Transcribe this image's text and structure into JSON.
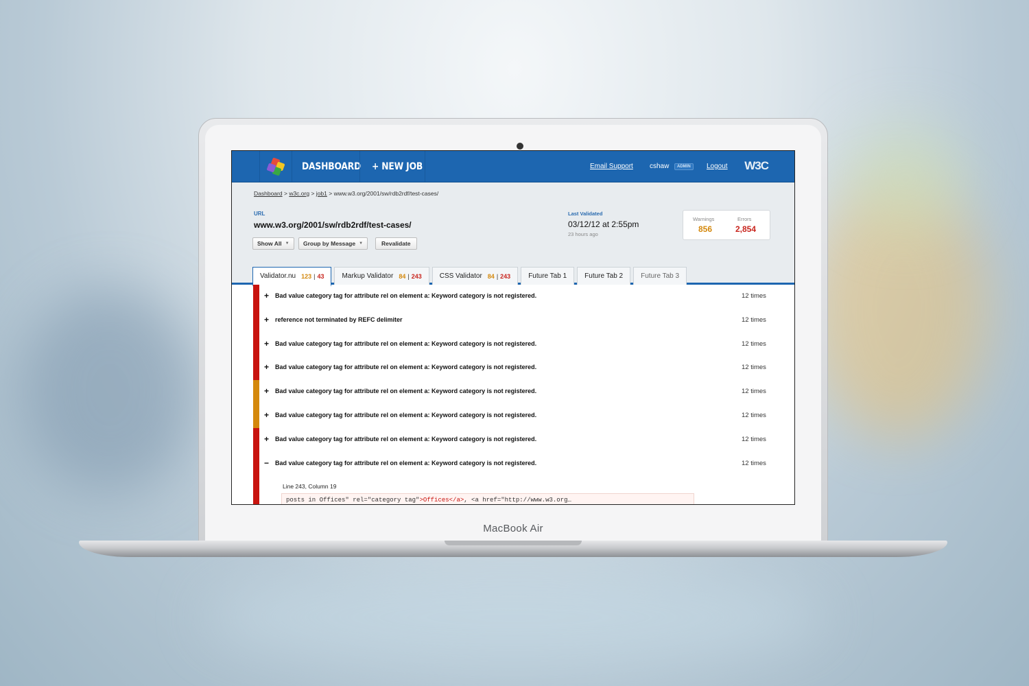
{
  "device": {
    "brand": "MacBook Air"
  },
  "nav": {
    "dashboard": "DASHBOARD",
    "new_job": "+ NEW JOB",
    "email_support": "Email Support",
    "username": "cshaw",
    "role_badge": "ADMIN",
    "logout": "Logout",
    "org_logo_text": "W3C"
  },
  "breadcrumb": {
    "items": [
      "Dashboard",
      "w3c.org",
      "job1"
    ],
    "current": "www.w3.org/2001/sw/rdb2rdf/test-cases/",
    "separator": ">"
  },
  "page": {
    "url_label": "URL",
    "url": "www.w3.org/2001/sw/rdb2rdf/test-cases/",
    "last_validated_label": "Last Validated",
    "last_validated": "03/12/12 at 2:55pm",
    "last_validated_ago": "23 hours ago",
    "warnings_label": "Warnings",
    "warnings": "856",
    "errors_label": "Errors",
    "errors": "2,854"
  },
  "toolbar": {
    "show_all": "Show All",
    "group_by": "Group by Message",
    "revalidate": "Revalidate"
  },
  "tabs": [
    {
      "label": "Validator.nu",
      "warnings": "123",
      "errors": "43",
      "active": true
    },
    {
      "label": "Markup Validator",
      "warnings": "84",
      "errors": "243",
      "active": false
    },
    {
      "label": "CSS Validator",
      "warnings": "84",
      "errors": "243",
      "active": false
    },
    {
      "label": "Future Tab 1"
    },
    {
      "label": "Future Tab 2"
    },
    {
      "label": "Future Tab 3"
    }
  ],
  "messages": [
    {
      "toggle": "+",
      "text": "Bad value category tag for attribute rel on element a: Keyword category is not registered.",
      "count": "12 times",
      "severity": "error"
    },
    {
      "toggle": "+",
      "text": "reference not terminated by REFC delimiter",
      "count": "12 times",
      "severity": "error"
    },
    {
      "toggle": "+",
      "text": "Bad value category tag for attribute rel on element a: Keyword category is not registered.",
      "count": "12 times",
      "severity": "error"
    },
    {
      "toggle": "+",
      "text": "Bad value category tag for attribute rel on element a: Keyword category is not registered.",
      "count": "12 times",
      "severity": "error"
    },
    {
      "toggle": "+",
      "text": "Bad value category tag for attribute rel on element a: Keyword category is not registered.",
      "count": "12 times",
      "severity": "warning"
    },
    {
      "toggle": "+",
      "text": "Bad value category tag for attribute rel on element a: Keyword category is not registered.",
      "count": "12 times",
      "severity": "warning"
    },
    {
      "toggle": "+",
      "text": "Bad value category tag for attribute rel on element a: Keyword category is not registered.",
      "count": "12 times",
      "severity": "error"
    },
    {
      "toggle": "−",
      "text": "Bad value category tag for attribute rel on element a: Keyword category is not registered.",
      "count": "12 times",
      "severity": "error"
    }
  ],
  "detail": {
    "location": "Line 243, Column 19",
    "code_before": "posts in Offices\" rel=\"category tag\"",
    "code_highlight": ">Offices</a>",
    "code_after": ", <a href=\"http://www.w3.org…"
  },
  "colors": {
    "brand_blue": "#1d66b0",
    "error": "#c8140f",
    "warning": "#d4880c"
  }
}
